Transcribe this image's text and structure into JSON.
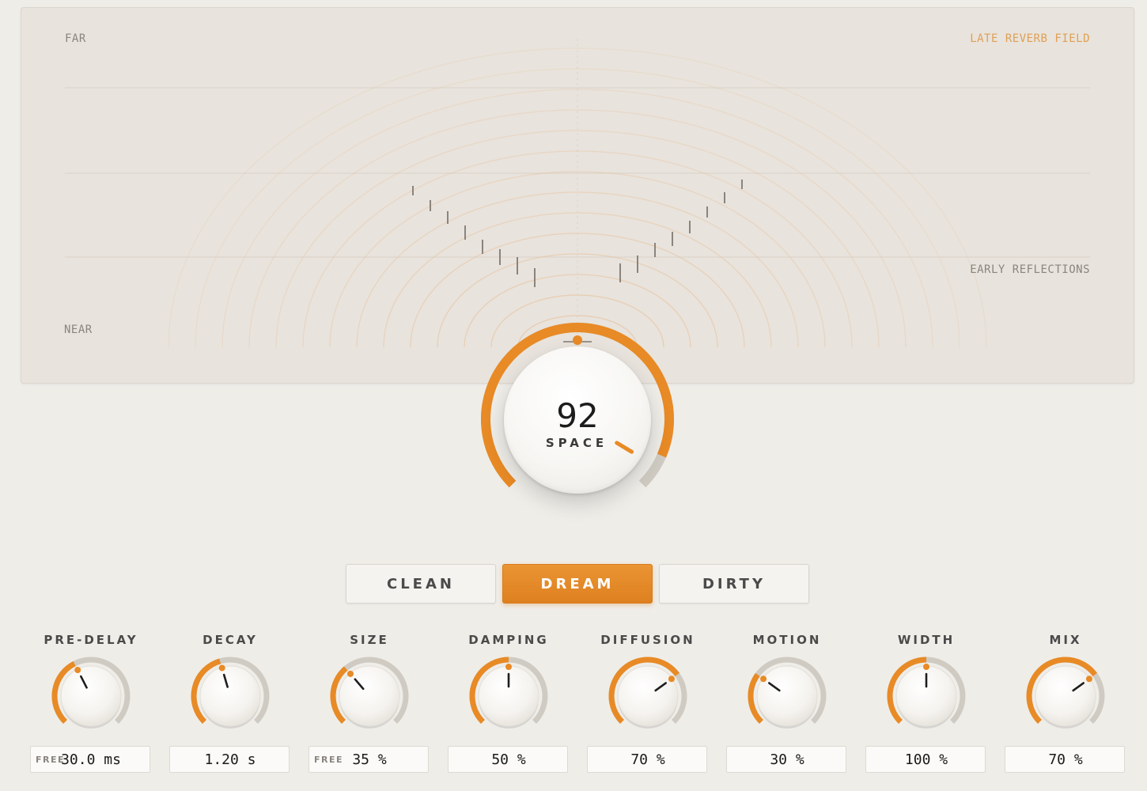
{
  "visualizer": {
    "label_far": "FAR",
    "label_near": "NEAR",
    "label_late": "LATE REVERB FIELD",
    "label_early": "EARLY REFLECTIONS",
    "accent_color": "#e0a055"
  },
  "space_knob": {
    "value": "92",
    "label": "SPACE",
    "level": 0.92
  },
  "modes": {
    "clean": "CLEAN",
    "dream": "DREAM",
    "dirty": "DIRTY",
    "active": "dream"
  },
  "colors": {
    "accent": "#e88a25",
    "track": "#cfcbc3"
  },
  "params": [
    {
      "label": "PRE-DELAY",
      "value": "30.0 ms",
      "free": "FREE",
      "level": 0.4
    },
    {
      "label": "DECAY",
      "value": "1.20 s",
      "free": "",
      "level": 0.44
    },
    {
      "label": "SIZE",
      "value": "35 %",
      "free": "FREE",
      "level": 0.35
    },
    {
      "label": "DAMPING",
      "value": "50 %",
      "free": "",
      "level": 0.5
    },
    {
      "label": "DIFFUSION",
      "value": "70 %",
      "free": "",
      "level": 0.7
    },
    {
      "label": "MOTION",
      "value": "30 %",
      "free": "",
      "level": 0.3
    },
    {
      "label": "WIDTH",
      "value": "100 %",
      "free": "",
      "level": 0.5
    },
    {
      "label": "MIX",
      "value": "70 %",
      "free": "",
      "level": 0.7
    }
  ]
}
